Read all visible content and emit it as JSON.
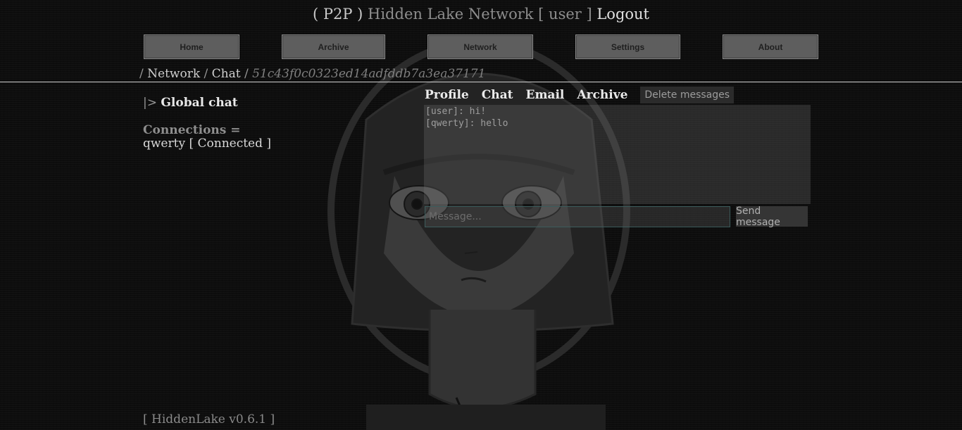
{
  "header": {
    "open_paren": "( ",
    "p2p": "P2P",
    "close_paren": " ) ",
    "network_name": "Hidden Lake Network",
    "user_label": " [ user ] ",
    "logout": "Logout"
  },
  "nav": [
    {
      "label": "Home"
    },
    {
      "label": "Archive"
    },
    {
      "label": "Network"
    },
    {
      "label": "Settings"
    },
    {
      "label": "About"
    }
  ],
  "breadcrumb": {
    "network": "Network",
    "chat": "Chat",
    "id": "51c43f0c0323ed14adfddb7a3ea37171",
    "sep": " / "
  },
  "sidebar": {
    "arrow": "|>",
    "title": "Global chat",
    "connections_title": "Connections =",
    "connections": [
      {
        "name": "qwerty",
        "status": "[ Connected ]"
      }
    ]
  },
  "chat": {
    "tabs": [
      {
        "label": "Profile"
      },
      {
        "label": "Chat"
      },
      {
        "label": "Email"
      },
      {
        "label": "Archive"
      }
    ],
    "delete_label": "Delete messages",
    "messages": [
      {
        "text": "[user]: hi!"
      },
      {
        "text": "[qwerty]: hello"
      }
    ],
    "input_placeholder": "Message...",
    "send_label": "Send message"
  },
  "footer": {
    "version": "[ HiddenLake v0.6.1 ]"
  }
}
